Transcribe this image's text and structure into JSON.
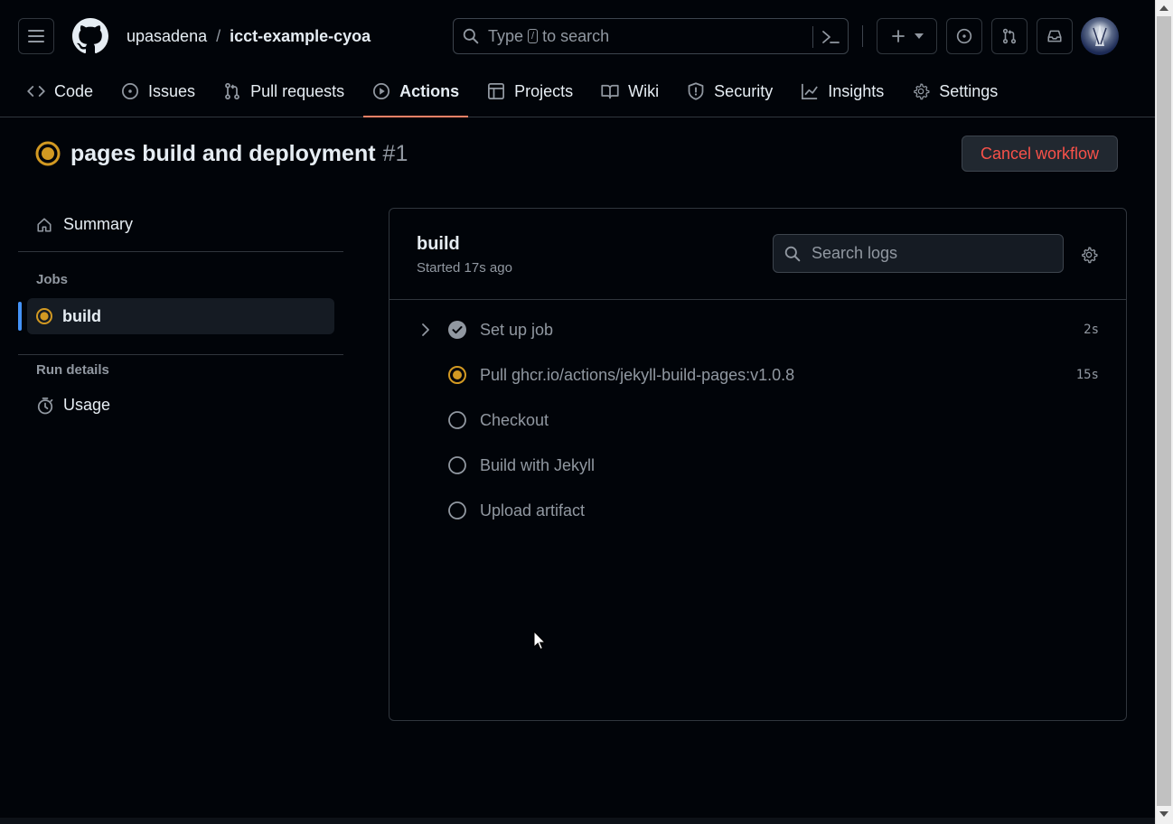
{
  "header": {
    "repo_owner": "upasadena",
    "repo_sep": "/",
    "repo_name": "icct-example-cyoa",
    "search": {
      "prefix": "Type",
      "key": "/",
      "suffix": "to search"
    }
  },
  "repo_nav": [
    {
      "label": "Code",
      "icon": "code-icon"
    },
    {
      "label": "Issues",
      "icon": "issue-opened-icon"
    },
    {
      "label": "Pull requests",
      "icon": "git-pull-request-icon"
    },
    {
      "label": "Actions",
      "icon": "play-icon",
      "active": true
    },
    {
      "label": "Projects",
      "icon": "table-icon"
    },
    {
      "label": "Wiki",
      "icon": "book-icon"
    },
    {
      "label": "Security",
      "icon": "shield-icon"
    },
    {
      "label": "Insights",
      "icon": "graph-icon"
    },
    {
      "label": "Settings",
      "icon": "gear-icon"
    }
  ],
  "run": {
    "title": "pages build and deployment",
    "number": "#1",
    "cancel_label": "Cancel workflow",
    "status": "in_progress"
  },
  "sidebar": {
    "summary_label": "Summary",
    "jobs_heading": "Jobs",
    "job_label": "build",
    "run_details_heading": "Run details",
    "usage_label": "Usage"
  },
  "job": {
    "title": "build",
    "started": "Started 17s ago",
    "search_placeholder": "Search logs",
    "steps": [
      {
        "name": "Set up job",
        "status": "success",
        "duration": "2s"
      },
      {
        "name": "Pull ghcr.io/actions/jekyll-build-pages:v1.0.8",
        "status": "in_progress",
        "duration": "15s"
      },
      {
        "name": "Checkout",
        "status": "pending",
        "duration": ""
      },
      {
        "name": "Build with Jekyll",
        "status": "pending",
        "duration": ""
      },
      {
        "name": "Upload artifact",
        "status": "pending",
        "duration": ""
      }
    ]
  },
  "colors": {
    "accent_active_tab": "#f78166",
    "in_progress": "#d29922",
    "cancel_text": "#f85149",
    "selected_marker": "#4493f8"
  }
}
